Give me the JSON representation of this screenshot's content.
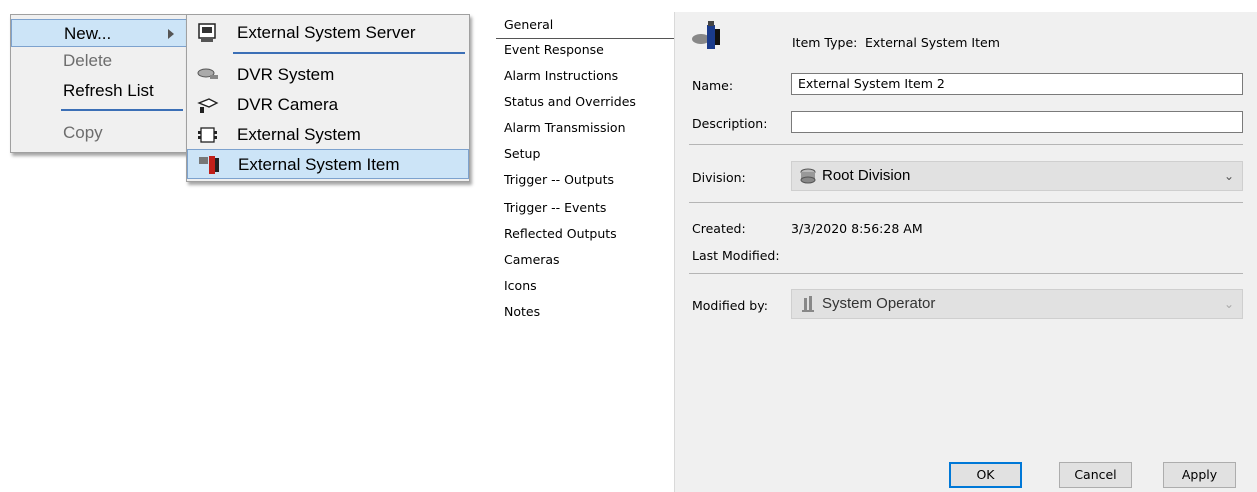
{
  "context_menu": {
    "items": [
      {
        "label": "New...",
        "state": "highlighted"
      },
      {
        "label": "Delete",
        "state": "disabled"
      },
      {
        "label": "Refresh List",
        "state": "enabled"
      },
      {
        "label": "Copy",
        "state": "disabled"
      }
    ]
  },
  "submenu": {
    "items": [
      {
        "label": "External System Server",
        "icon": "server-icon"
      },
      {
        "label": "DVR System",
        "icon": "dvr-system-icon"
      },
      {
        "label": "DVR Camera",
        "icon": "dvr-camera-icon"
      },
      {
        "label": "External System",
        "icon": "external-system-icon"
      },
      {
        "label": "External System Item",
        "icon": "external-system-item-icon",
        "state": "highlighted"
      }
    ]
  },
  "dialog": {
    "nav": [
      "General",
      "Event Response",
      "Alarm Instructions",
      "Status and Overrides",
      "Alarm Transmission",
      "Setup",
      "Trigger -- Outputs",
      "Trigger -- Events",
      "Reflected Outputs",
      "Cameras",
      "Icons",
      "Notes"
    ],
    "item_type_label": "Item Type:",
    "item_type_value": "External System Item",
    "name_label": "Name:",
    "name_value": "External System Item 2",
    "description_label": "Description:",
    "description_value": "",
    "division_label": "Division:",
    "division_value": "Root Division",
    "created_label": "Created:",
    "created_value": "3/3/2020 8:56:28 AM",
    "last_modified_label": "Last Modified:",
    "last_modified_value": "",
    "modified_by_label": "Modified by:",
    "modified_by_value": "System Operator",
    "buttons": {
      "ok": "OK",
      "cancel": "Cancel",
      "apply": "Apply"
    }
  },
  "colors": {
    "highlight": "#cce4f7",
    "highlight_border": "#7da2ce",
    "separator": "#3b6fb6",
    "default_button": "#0078d7"
  }
}
